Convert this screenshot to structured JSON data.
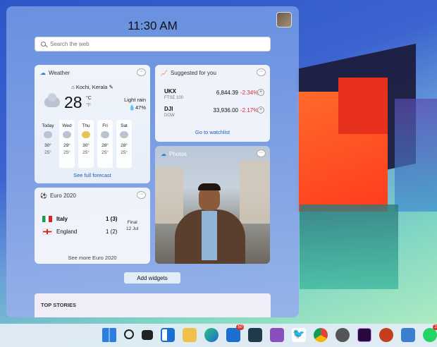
{
  "clock": "11:30 AM",
  "search": {
    "placeholder": "Search the web"
  },
  "weather": {
    "title": "Weather",
    "location": "Kochi, Kerala",
    "temp": "28",
    "unit_c": "°C",
    "unit_f": "°F",
    "condition": "Light rain",
    "humidity": "47%",
    "days": [
      {
        "name": "Today",
        "hi": "30°",
        "lo": "25°"
      },
      {
        "name": "Wed",
        "hi": "29°",
        "lo": "25°"
      },
      {
        "name": "Thu",
        "hi": "30°",
        "lo": "25°"
      },
      {
        "name": "Fri",
        "hi": "28°",
        "lo": "25°"
      },
      {
        "name": "Sat",
        "hi": "28°",
        "lo": "25°"
      }
    ],
    "forecast_link": "See full forecast"
  },
  "stocks": {
    "title": "Suggested for you",
    "items": [
      {
        "symbol": "UKX",
        "exchange": "FTSE 100",
        "price": "6,844.39",
        "change": "-2.34%"
      },
      {
        "symbol": "DJI",
        "exchange": "DOW",
        "price": "33,936.00",
        "change": "-2.17%"
      }
    ],
    "watchlist_link": "Go to watchlist"
  },
  "photos": {
    "title": "Photos"
  },
  "euro": {
    "title": "Euro 2020",
    "teams": [
      {
        "name": "Italy",
        "score": "1 (3)"
      },
      {
        "name": "England",
        "score": "1 (2)"
      }
    ],
    "status": "Final",
    "date": "12 Jul",
    "more_link": "See more Euro 2020"
  },
  "add_widgets": "Add widgets",
  "top_stories": "TOP STORIES",
  "taskbar": {
    "mail_badge": "50",
    "whatsapp_badge": "23"
  },
  "colors": {
    "accent": "#1a5fb4",
    "negative": "#d12b2b"
  }
}
